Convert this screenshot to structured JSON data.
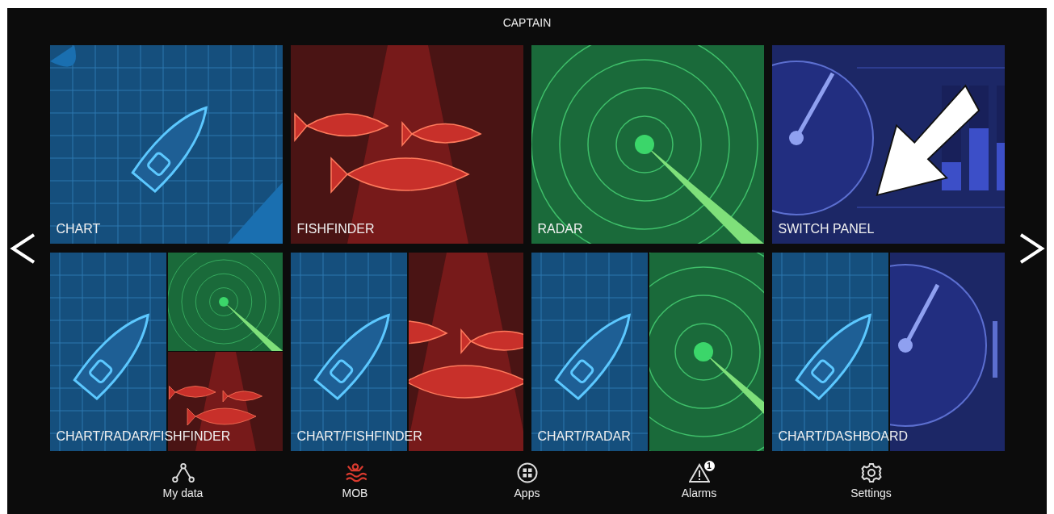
{
  "header": {
    "title": "CAPTAIN"
  },
  "tiles": [
    {
      "label": "CHART",
      "panes": [
        {
          "kind": "chart"
        }
      ]
    },
    {
      "label": "FISHFINDER",
      "panes": [
        {
          "kind": "fishfinder"
        }
      ]
    },
    {
      "label": "RADAR",
      "panes": [
        {
          "kind": "radar"
        }
      ]
    },
    {
      "label": "SWITCH PANEL",
      "panes": [
        {
          "kind": "switch_panel"
        }
      ]
    },
    {
      "label": "CHART/RADAR/FISHFINDER",
      "panes": [
        {
          "kind": "chart"
        },
        {
          "kind": "radar"
        },
        {
          "kind": "fishfinder"
        }
      ]
    },
    {
      "label": "CHART/FISHFINDER",
      "panes": [
        {
          "kind": "chart"
        },
        {
          "kind": "fishfinder"
        }
      ]
    },
    {
      "label": "CHART/RADAR",
      "panes": [
        {
          "kind": "chart"
        },
        {
          "kind": "radar"
        }
      ]
    },
    {
      "label": "CHART/DASHBOARD",
      "panes": [
        {
          "kind": "chart"
        },
        {
          "kind": "dashboard"
        }
      ]
    }
  ],
  "nav": [
    {
      "label": "My data",
      "kind": "data"
    },
    {
      "label": "MOB",
      "kind": "mob",
      "color": "#d83a2e"
    },
    {
      "label": "Apps",
      "kind": "apps"
    },
    {
      "label": "Alarms",
      "kind": "alarm",
      "badge": "1"
    },
    {
      "label": "Settings",
      "kind": "settings"
    }
  ]
}
